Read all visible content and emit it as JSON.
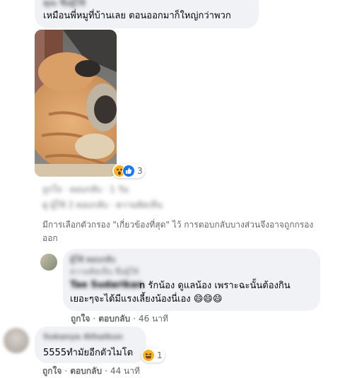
{
  "comment1": {
    "author": "คุณ ชื่อผู้ใช้",
    "text": "เหมือนพี่หมูที่บ้านเลย ตอนออกมาก็ใหญ่กว่าพวก",
    "reactions": {
      "icons": [
        "wow-emoji",
        "like-icon"
      ],
      "count": "3"
    },
    "meta_blur1": "ถูกใจ · ตอบกลับ · 1 วัน",
    "meta_blur2": "ดู ผู้ใช้ 2 ตอบกลับ · ความคิดเห็น"
  },
  "filter_notice": "มีการเลือกตัวกรอง \"เกี่ยวข้องที่สุด\" ไว้ การตอบกลับบางส่วนจึงอาจถูกกรองออก",
  "reply1": {
    "author": "ผู้ใช้ ตอบกลับ",
    "sub_blur": "ความคิดเห็น ชื่อผู้ใช้",
    "tag_blur": "Tae Sudarikan",
    "text_line1": "n รักน้อง ดูแลน้อง เพราะฉะนั้นต้องกิน",
    "text_line2": "เยอะๆจะได้มีแรงเลี้ยงน้องนี่เอง 😄😄😄",
    "like_label": "ถูกใจ",
    "reply_label": "ตอบกลับ",
    "time": "46 นาที"
  },
  "comment2": {
    "author": "Sukanya Athaikun",
    "text": "5555ทำมัยอีกตัวไมโต",
    "reactions": {
      "icons": [
        "haha-emoji"
      ],
      "count": "1"
    },
    "like_label": "ถูกใจ",
    "reply_label": "ตอบกลับ",
    "time": "44 นาที"
  },
  "colors": {
    "bubble": "#f0f2f5",
    "secondary_text": "#65676b",
    "like_blue": "#1877f2",
    "emoji_yellow": "#f7b125",
    "notice_text": "#65676b"
  }
}
